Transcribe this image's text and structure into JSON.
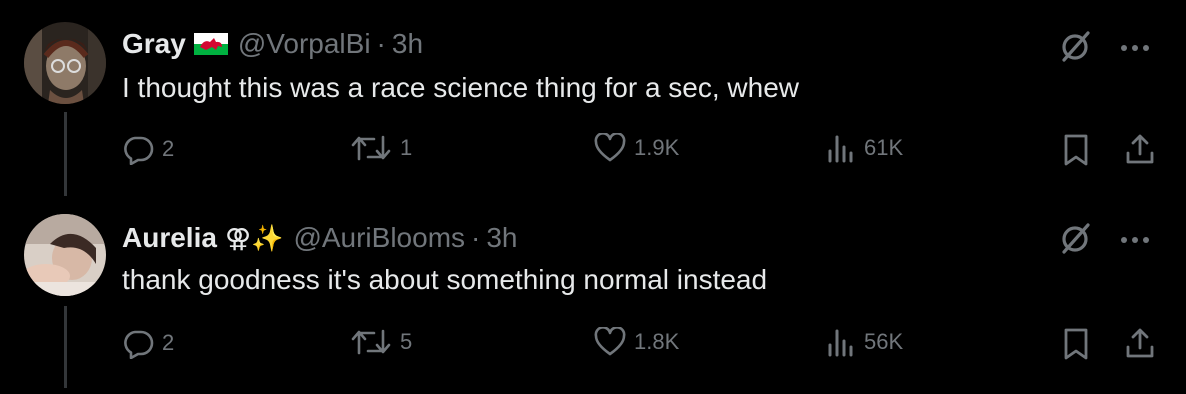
{
  "tweets": [
    {
      "name": "Gray",
      "badge": "🏴",
      "handle": "@VorpalBi",
      "separator": "·",
      "time": "3h",
      "text": "I thought this was a race science thing for a sec, whew",
      "replies": "2",
      "retweets": "1",
      "likes": "1.9K",
      "views": "61K"
    },
    {
      "name": "Aurelia",
      "badge": "⚢✨",
      "handle": "@AuriBlooms",
      "separator": "·",
      "time": "3h",
      "text": "thank goodness it's about something normal instead",
      "replies": "2",
      "retweets": "5",
      "likes": "1.8K",
      "views": "56K"
    }
  ],
  "icons": {
    "grok": "grok-icon",
    "more": "more-icon",
    "reply": "reply-icon",
    "retweet": "retweet-icon",
    "like": "heart-icon",
    "views": "views-icon",
    "bookmark": "bookmark-icon",
    "share": "share-icon"
  },
  "colors": {
    "background": "#000000",
    "text": "#e7e9ea",
    "muted": "#71767b",
    "thread": "#333639"
  }
}
